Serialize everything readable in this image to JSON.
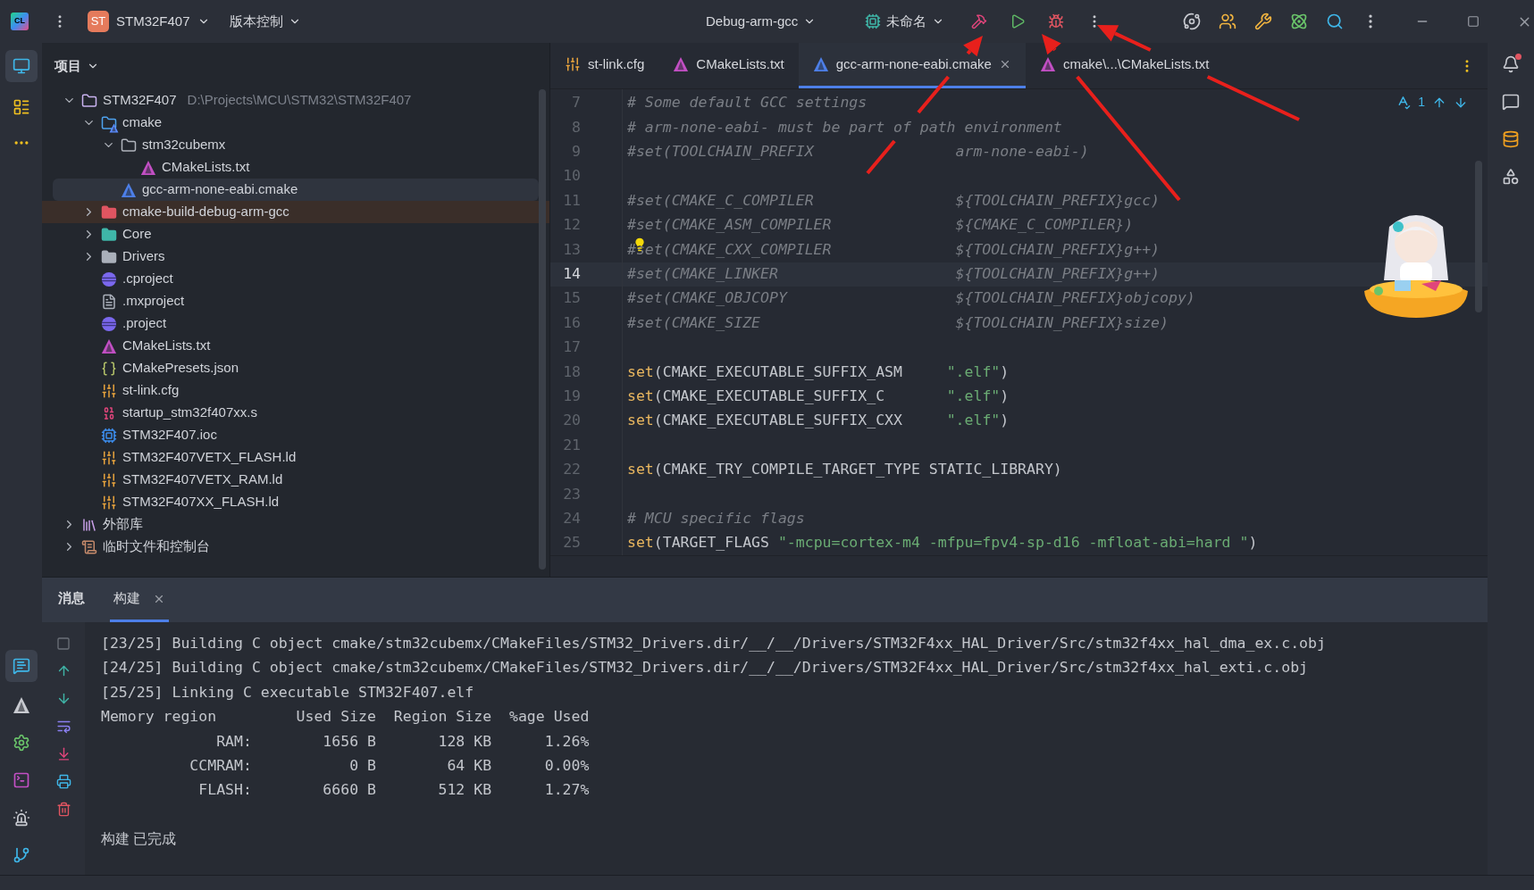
{
  "titlebar": {
    "app_logo": "CL",
    "project_badge": "ST",
    "project": "STM32F407",
    "vcs": "版本控制",
    "run_config": "Debug-arm-gcc",
    "target": "未命名"
  },
  "project_panel": {
    "title": "项目",
    "tree": [
      {
        "name": "STM32F407",
        "path": "D:\\Projects\\MCU\\STM32\\STM32F407",
        "kind": "module-folder",
        "expanded": true,
        "selected": false,
        "children": [
          {
            "name": "cmake",
            "kind": "cmake-folder",
            "expanded": true,
            "selected": false,
            "children": [
              {
                "name": "stm32cubemx",
                "kind": "folder",
                "expanded": true,
                "selected": false,
                "children": [
                  {
                    "name": "CMakeLists.txt",
                    "kind": "cmake",
                    "selected": false
                  }
                ]
              },
              {
                "name": "gcc-arm-none-eabi.cmake",
                "kind": "cmake-blue",
                "selected": true
              }
            ]
          },
          {
            "name": "cmake-build-debug-arm-gcc",
            "kind": "excluded-folder",
            "expanded": false,
            "selected": false
          },
          {
            "name": "Core",
            "kind": "core-folder",
            "expanded": false,
            "selected": false
          },
          {
            "name": "Drivers",
            "kind": "plain-folder",
            "expanded": false,
            "selected": false
          },
          {
            "name": ".cproject",
            "kind": "eclipse",
            "selected": false
          },
          {
            "name": ".mxproject",
            "kind": "text",
            "selected": false
          },
          {
            "name": ".project",
            "kind": "eclipse",
            "selected": false
          },
          {
            "name": "CMakeLists.txt",
            "kind": "cmake",
            "selected": false
          },
          {
            "name": "CMakePresets.json",
            "kind": "json",
            "selected": false
          },
          {
            "name": "st-link.cfg",
            "kind": "config",
            "selected": false
          },
          {
            "name": "startup_stm32f407xx.s",
            "kind": "asm",
            "selected": false
          },
          {
            "name": "STM32F407.ioc",
            "kind": "ioc",
            "selected": false
          },
          {
            "name": "STM32F407VETX_FLASH.ld",
            "kind": "config",
            "selected": false
          },
          {
            "name": "STM32F407VETX_RAM.ld",
            "kind": "config",
            "selected": false
          },
          {
            "name": "STM32F407XX_FLASH.ld",
            "kind": "config",
            "selected": false
          }
        ]
      },
      {
        "name": "外部库",
        "kind": "library",
        "expanded": false,
        "selected": false
      },
      {
        "name": "临时文件和控制台",
        "kind": "scratches",
        "expanded": false,
        "selected": false
      }
    ]
  },
  "editor": {
    "tabs": [
      {
        "label": "st-link.cfg",
        "kind": "config",
        "selected": false
      },
      {
        "label": "CMakeLists.txt",
        "kind": "cmake",
        "selected": false
      },
      {
        "label": "gcc-arm-none-eabi.cmake",
        "kind": "cmake-blue",
        "selected": true
      },
      {
        "label": "cmake\\...\\CMakeLists.txt",
        "kind": "cmake",
        "selected": false
      }
    ],
    "inspections": "1",
    "lines": [
      {
        "number": "7",
        "current": false,
        "segments": [
          {
            "kind": "comment",
            "text": "# Some default GCC settings"
          }
        ]
      },
      {
        "number": "8",
        "current": false,
        "segments": [
          {
            "kind": "comment",
            "text": "# arm-none-eabi- must be part of path environment"
          }
        ]
      },
      {
        "number": "9",
        "current": false,
        "segments": [
          {
            "kind": "comment",
            "text": "#set(TOOLCHAIN_PREFIX                arm-none-eabi-)"
          }
        ]
      },
      {
        "number": "10",
        "current": false
      },
      {
        "number": "11",
        "current": false,
        "segments": [
          {
            "kind": "comment",
            "text": "#set(CMAKE_C_COMPILER                ${TOOLCHAIN_PREFIX}gcc)"
          }
        ]
      },
      {
        "number": "12",
        "current": false,
        "segments": [
          {
            "kind": "comment",
            "text": "#set(CMAKE_ASM_COMPILER              ${CMAKE_C_COMPILER})"
          }
        ]
      },
      {
        "number": "13",
        "current": false,
        "bulb": true,
        "segments": [
          {
            "kind": "comment",
            "text": "#set(CMAKE_CXX_COMPILER              ${TOOLCHAIN_PREFIX}g++)"
          }
        ]
      },
      {
        "number": "14",
        "current": true,
        "segments": [
          {
            "kind": "comment",
            "text": "#set(CMAKE_LINKER                    ${TOOLCHAIN_PREFIX}g++)"
          }
        ]
      },
      {
        "number": "15",
        "current": false,
        "segments": [
          {
            "kind": "comment",
            "text": "#set(CMAKE_OBJCOPY                   ${TOOLCHAIN_PREFIX}objcopy)"
          }
        ]
      },
      {
        "number": "16",
        "current": false,
        "segments": [
          {
            "kind": "comment",
            "text": "#set(CMAKE_SIZE                      ${TOOLCHAIN_PREFIX}size)"
          }
        ]
      },
      {
        "number": "17",
        "current": false
      },
      {
        "number": "18",
        "current": false,
        "segments": [
          {
            "kind": "keyword",
            "text": "set"
          },
          {
            "kind": "plain",
            "text": "(CMAKE_EXECUTABLE_SUFFIX_ASM     "
          },
          {
            "kind": "string",
            "text": "\".elf\""
          },
          {
            "kind": "plain",
            "text": ")"
          }
        ]
      },
      {
        "number": "19",
        "current": false,
        "segments": [
          {
            "kind": "keyword",
            "text": "set"
          },
          {
            "kind": "plain",
            "text": "(CMAKE_EXECUTABLE_SUFFIX_C       "
          },
          {
            "kind": "string",
            "text": "\".elf\""
          },
          {
            "kind": "plain",
            "text": ")"
          }
        ]
      },
      {
        "number": "20",
        "current": false,
        "segments": [
          {
            "kind": "keyword",
            "text": "set"
          },
          {
            "kind": "plain",
            "text": "(CMAKE_EXECUTABLE_SUFFIX_CXX     "
          },
          {
            "kind": "string",
            "text": "\".elf\""
          },
          {
            "kind": "plain",
            "text": ")"
          }
        ]
      },
      {
        "number": "21",
        "current": false
      },
      {
        "number": "22",
        "current": false,
        "segments": [
          {
            "kind": "keyword",
            "text": "set"
          },
          {
            "kind": "plain",
            "text": "(CMAKE_TRY_COMPILE_TARGET_TYPE STATIC_LIBRARY)"
          }
        ]
      },
      {
        "number": "23",
        "current": false
      },
      {
        "number": "24",
        "current": false,
        "segments": [
          {
            "kind": "comment",
            "text": "# MCU specific flags"
          }
        ]
      },
      {
        "number": "25",
        "current": false,
        "segments": [
          {
            "kind": "keyword",
            "text": "set"
          },
          {
            "kind": "plain",
            "text": "(TARGET_FLAGS "
          },
          {
            "kind": "string",
            "text": "\"-mcpu=cortex-m4 -mfpu=fpv4-sp-d16 -mfloat-abi=hard \""
          },
          {
            "kind": "plain",
            "text": ")"
          }
        ]
      }
    ]
  },
  "bottom_panel": {
    "tabs": [
      {
        "label": "消息",
        "selected": false
      },
      {
        "label": "构建",
        "selected": true
      }
    ],
    "output": [
      "[23/25] Building C object cmake/stm32cubemx/CMakeFiles/STM32_Drivers.dir/__/__/Drivers/STM32F4xx_HAL_Driver/Src/stm32f4xx_hal_dma_ex.c.obj",
      "[24/25] Building C object cmake/stm32cubemx/CMakeFiles/STM32_Drivers.dir/__/__/Drivers/STM32F4xx_HAL_Driver/Src/stm32f4xx_hal_exti.c.obj",
      "[25/25] Linking C executable STM32F407.elf",
      "Memory region         Used Size  Region Size  %age Used",
      "             RAM:        1656 B       128 KB      1.26%",
      "          CCMRAM:           0 B        64 KB      0.00%",
      "           FLASH:        6660 B       512 KB      1.27%"
    ],
    "status": "构建 已完成"
  }
}
